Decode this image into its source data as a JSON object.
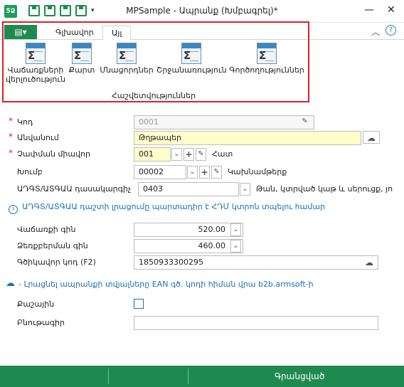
{
  "titlebar": {
    "title": "MPSample - Ապրանք (Խմբագրել)*",
    "app_icon": "5Ձ",
    "qat_drop": "▾",
    "minimize": "—",
    "close": "✕"
  },
  "ribbon": {
    "file_tab": "▤▾",
    "tabs": [
      "Գլխավոր",
      "Այլ"
    ],
    "active_tab": "Այլ",
    "collapse": "︿",
    "help": "?",
    "buttons": [
      {
        "label_line1": "Վաճառքների",
        "label_line2": "վերլուծություն"
      },
      {
        "label_line1": "Քարտ",
        "label_line2": ""
      },
      {
        "label_line1": "Մնացորդներ",
        "label_line2": ""
      },
      {
        "label_line1": "Շրջանառություն",
        "label_line2": ""
      },
      {
        "label_line1": "Գործողություններ",
        "label_line2": ""
      }
    ],
    "group_label": "Հաշվետվություններ"
  },
  "form": {
    "code": {
      "label": "Կոդ",
      "value": "0001"
    },
    "name": {
      "label": "Անվանում",
      "value": "Թղթապեր"
    },
    "unit": {
      "label": "Չափման միավոր",
      "value": "001",
      "after": "Հատ"
    },
    "group": {
      "label": "Խումբ",
      "value": "00002",
      "after": "Կախնամթերք"
    },
    "classifier": {
      "label": "ԱԴԳՏ/ԱՏԳԱԱ դասակարգիչ",
      "value": "0403",
      "after": "Թան, կտրված կաթ և սերուցք, յո"
    },
    "info_text": "ԱԴԳՏ/ԱՏԳԱԱ դաշտի լրացումը պարտադիր է ՀԴՄ կտրոն տպելու համար",
    "sale_price": {
      "label": "Վաճառքի գին",
      "value": "520.00"
    },
    "retail_price": {
      "label": "Ձեռքբերման գին",
      "value": "460.00"
    },
    "barcode": {
      "label": "Գծիկավոր կոդ (F2)",
      "value": "1850933300295"
    },
    "cloud_link": "- Լրացնել ապրանքի տվյալները EAN գծ. կոդի հիման վրա b2b.armsoft-ի",
    "service": {
      "label": "Քաշային"
    },
    "notes": {
      "label": "Բնութագիր",
      "value": ""
    }
  },
  "status": {
    "text": "Գրանցված"
  },
  "colors": {
    "accent_green": "#1e8a50",
    "highlight_red": "#d9222a",
    "link_blue": "#1a6eb7",
    "required_yellow": "#ffffcc"
  },
  "icons": {
    "ribbon_buttons": "report-sigma-icon",
    "cloud": "cloud-icon",
    "info": "info-icon",
    "edit": "pencil-icon",
    "add": "plus-icon"
  }
}
